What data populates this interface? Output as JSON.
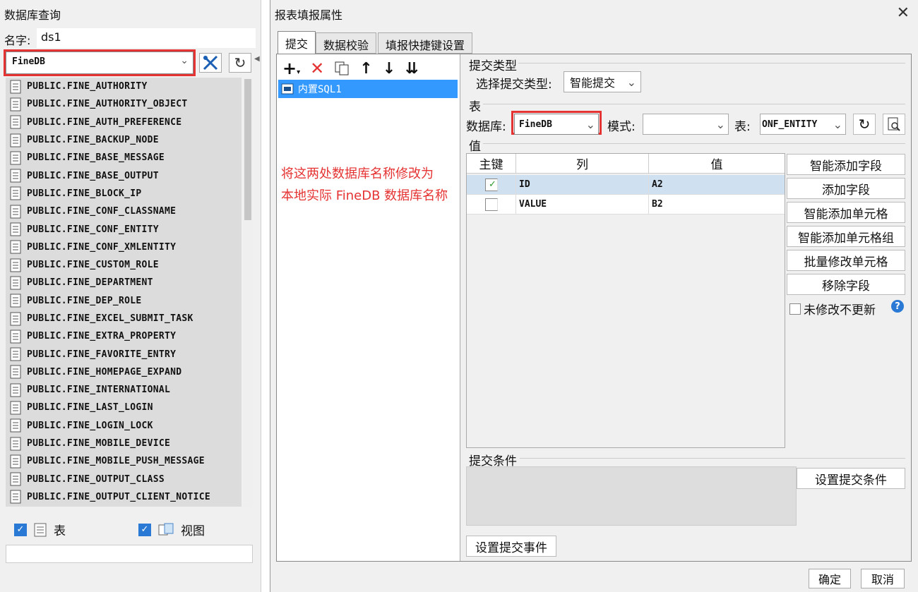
{
  "left_panel": {
    "title": "数据库查询",
    "name_label": "名字:",
    "name_value": "ds1",
    "db_selected": "FineDB",
    "tables": [
      "PUBLIC.FINE_AUTHORITY",
      "PUBLIC.FINE_AUTHORITY_OBJECT",
      "PUBLIC.FINE_AUTH_PREFERENCE",
      "PUBLIC.FINE_BACKUP_NODE",
      "PUBLIC.FINE_BASE_MESSAGE",
      "PUBLIC.FINE_BASE_OUTPUT",
      "PUBLIC.FINE_BLOCK_IP",
      "PUBLIC.FINE_CONF_CLASSNAME",
      "PUBLIC.FINE_CONF_ENTITY",
      "PUBLIC.FINE_CONF_XMLENTITY",
      "PUBLIC.FINE_CUSTOM_ROLE",
      "PUBLIC.FINE_DEPARTMENT",
      "PUBLIC.FINE_DEP_ROLE",
      "PUBLIC.FINE_EXCEL_SUBMIT_TASK",
      "PUBLIC.FINE_EXTRA_PROPERTY",
      "PUBLIC.FINE_FAVORITE_ENTRY",
      "PUBLIC.FINE_HOMEPAGE_EXPAND",
      "PUBLIC.FINE_INTERNATIONAL",
      "PUBLIC.FINE_LAST_LOGIN",
      "PUBLIC.FINE_LOGIN_LOCK",
      "PUBLIC.FINE_MOBILE_DEVICE",
      "PUBLIC.FINE_MOBILE_PUSH_MESSAGE",
      "PUBLIC.FINE_OUTPUT_CLASS",
      "PUBLIC.FINE_OUTPUT_CLIENT_NOTICE"
    ],
    "show_tables_label": "表",
    "show_views_label": "视图"
  },
  "dialog": {
    "title": "报表填报属性",
    "tabs": [
      "提交",
      "数据校验",
      "填报快捷键设置"
    ],
    "sql_item": "内置SQL1",
    "note_line1": "将这两处数据库名称修改为",
    "note_line2": "本地实际 FineDB 数据库名称",
    "submit_type_group": "提交类型",
    "submit_type_label": "选择提交类型:",
    "submit_type_value": "智能提交",
    "table_group": "表",
    "db_label": "数据库:",
    "db_value": "FineDB",
    "schema_label": "模式:",
    "schema_value": "",
    "table_label": "表:",
    "table_value": "ONF_ENTITY",
    "value_group": "值",
    "grid_headers": [
      "主键",
      "列",
      "值"
    ],
    "grid_rows": [
      {
        "key": true,
        "column": "ID",
        "value": "A2"
      },
      {
        "key": false,
        "column": "VALUE",
        "value": "B2"
      }
    ],
    "side_buttons": [
      "智能添加字段",
      "添加字段",
      "智能添加单元格",
      "智能添加单元格组",
      "批量修改单元格",
      "移除字段"
    ],
    "no_update_label": "未修改不更新",
    "condition_group": "提交条件",
    "set_condition_btn": "设置提交条件",
    "set_event_btn": "设置提交事件",
    "ok_btn": "确定",
    "cancel_btn": "取消"
  },
  "colors": {
    "highlight": "#e53333",
    "selection": "#3399ff",
    "check": "#2a7ad5"
  }
}
